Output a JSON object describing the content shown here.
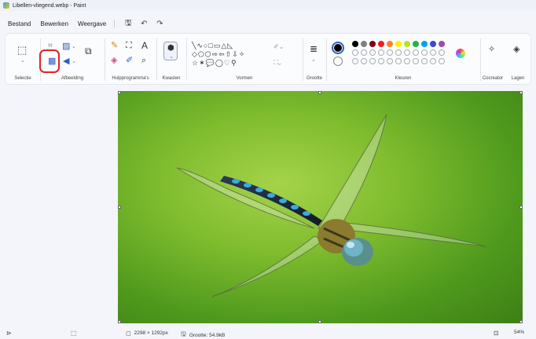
{
  "window": {
    "title": "Libellen-vliegend.webp - Paint",
    "app_icon": "paint-icon"
  },
  "menubar": {
    "items": [
      "Bestand",
      "Bewerken",
      "Weergave"
    ],
    "save_icon": "save-icon",
    "undo_icon": "undo-icon",
    "redo_icon": "redo-icon"
  },
  "ribbon": {
    "groups": {
      "selectie": "Selectie",
      "afbeelding": "Afbeelding",
      "hulpprogrammas": "Hulpprogramma's",
      "kwasten": "Kwasten",
      "vormen": "Vormen",
      "grootte": "Grootte",
      "kleuren": "Kleuren",
      "cocreator": "Cocreator",
      "lagen": "Lagen"
    },
    "text_tool_glyph": "A",
    "highlighted_tool": "resize-image-icon",
    "colors": {
      "primary": "#000000",
      "secondary": "#ffffff",
      "palette_row1": [
        "#000000",
        "#7f7f7f",
        "#880015",
        "#ed1c24",
        "#ff7f27",
        "#fff200",
        "#b5e61d",
        "#22b14c",
        "#00a2e8",
        "#3f48cc",
        "#a349a4"
      ],
      "palette_row2": [
        "#ffffff",
        "#c3c3c3",
        "#b97a57",
        "#ffaec9",
        "#ffc90e",
        "#efe4b0",
        "#b5e61d",
        "#99d9ea",
        "#7092be",
        "#c8bfe7",
        "#a3a3a3"
      ]
    }
  },
  "statusbar": {
    "cursor_icon": "pointer-icon",
    "selection_icon": "selection-size-icon",
    "dimensions": "2298 × 1292px",
    "size_label": "Grootte: 54.9kB",
    "zoom": "54%"
  }
}
